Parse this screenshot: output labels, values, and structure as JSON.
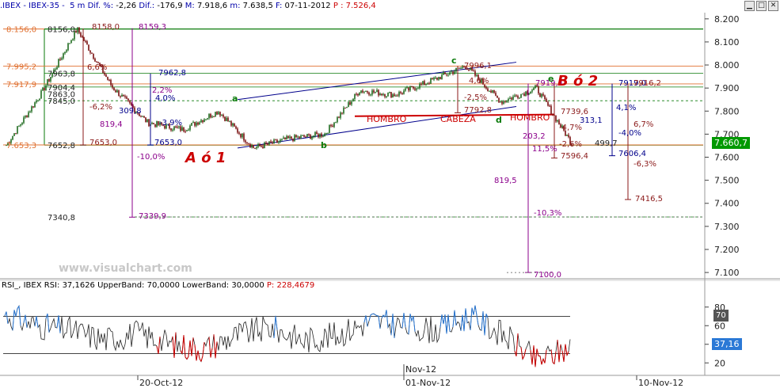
{
  "window": {
    "controls": [
      "▁",
      "□",
      "✕"
    ]
  },
  "price_panel": {
    "header": {
      "symbol": ".IBEX - IBEX-35 -",
      "interval": "5 m",
      "dif_label": "Dif. %:",
      "dif_pct": "-2,26",
      "dif_abs_label": "Dif.:",
      "dif_abs": "-176,9",
      "max_label": "M:",
      "max": "7.918,6",
      "min_label": "m:",
      "min": "7.638,5",
      "date_label": "F:",
      "date": "07-11-2012",
      "price_label": "P :",
      "price": "7.526,4"
    },
    "current_value": "7.660,7",
    "watermark": "www.visualchart.com"
  },
  "rsi_panel": {
    "header": {
      "label": "RSI_, IBEX RSI:",
      "rsi": "37,1626",
      "upper_label": "UpperBand:",
      "upper": "70,0000",
      "lower_label": "LowerBand:",
      "lower": "30,0000",
      "p_label": "P:",
      "p": "228,4679"
    },
    "current_value": "37,16",
    "band_upper_box": "70"
  },
  "colors": {
    "header_blue": "#0000aa",
    "header_red": "#cc0000",
    "up_bar": "#1f6b1f",
    "down_bar": "#7a1010",
    "green_line": "#0a7a0a",
    "orange_line": "#e07030",
    "blue_line": "#00008b",
    "purple_line": "#8b008b",
    "red_line": "#cc0000",
    "value_box_green": "#009900",
    "value_box_blue": "#2b79d6"
  },
  "chart_data": [
    {
      "type": "line",
      "description_of_series": "IBEX-35 5-minute price (approximate path)",
      "x": [
        "2012-10-16",
        "2012-10-17",
        "2012-10-18",
        "2012-10-19",
        "2012-10-22",
        "2012-10-23",
        "2012-10-24",
        "2012-10-25",
        "2012-10-26",
        "2012-10-29",
        "2012-10-30",
        "2012-10-31",
        "2012-11-01",
        "2012-11-02",
        "2012-11-05",
        "2012-11-06",
        "2012-11-07"
      ],
      "series": [
        {
          "values": [
            7653,
            7880,
            8156,
            7904,
            7750,
            7720,
            7800,
            7640,
            7680,
            7700,
            7890,
            7870,
            7930,
            7996,
            7840,
            7900,
            7660
          ]
        }
      ],
      "ylim": [
        7090,
        8220
      ],
      "y_ticks": [
        "8.200",
        "8.100",
        "8.000",
        "7.900",
        "7.800",
        "7.700",
        "7.600",
        "7.500",
        "7.400",
        "7.300",
        "7.200",
        "7.100"
      ],
      "x_ticks": [
        "20-Oct-12",
        "01-Nov-12",
        "Nov-12",
        "10-Nov-12"
      ],
      "horizontal_levels_green": [
        8156.0,
        7963.8,
        7904.4,
        7845.0,
        7652.8,
        7340.8
      ],
      "horizontal_levels_orange": [
        8156.0,
        7995.2,
        7917.9,
        7653.3
      ],
      "price_tags": [
        "8156,0",
        "7963,8",
        "7904,4",
        "7863,0",
        "7845,0",
        "7652,8",
        "7340,8"
      ],
      "level_tags": [
        "8.156,0",
        "7.995,2",
        "7.917,9",
        "7.653,3"
      ],
      "annotations": {
        "measures": [
          "8158,0",
          "8159,3",
          "7962,8",
          "7653,0",
          "7653,0",
          "7339,9",
          "6,6%",
          "-6,2%",
          "819,4",
          "309,8",
          "-3,9%",
          "4,0%",
          "-10,0%",
          "2,2%",
          "7996,1",
          "-2,5%",
          "7792,8",
          "7919,4",
          "4,6%",
          "7739,6",
          "-4,7%",
          "203,2",
          "11,5%",
          "-2,6%",
          "7596,4",
          "819,5",
          "-10,3%",
          "7100,0",
          "7919,0",
          "7916,2",
          "4,1%",
          "313,1",
          "-4,0%",
          "499,7",
          "7606,4",
          "6,7%",
          "-6,3%",
          "7416,5"
        ],
        "pattern_labels": [
          "HOMBRO",
          "CABEZA",
          "HOMBRO"
        ],
        "wave_labels": [
          "a",
          "b",
          "c",
          "d",
          "e"
        ],
        "big_labels": [
          "A ó 1",
          "B ó 2"
        ]
      }
    },
    {
      "type": "line",
      "description_of_series": "RSI oscillator (approximate path)",
      "series": [
        {
          "values": [
            72,
            60,
            55,
            45,
            52,
            40,
            35,
            50,
            58,
            44,
            50,
            65,
            60,
            55,
            70,
            50,
            22,
            37
          ]
        }
      ],
      "ylim": [
        10,
        90
      ],
      "y_ticks": [
        "80",
        "60",
        "40",
        "20"
      ],
      "bands": [
        70,
        30
      ]
    }
  ]
}
